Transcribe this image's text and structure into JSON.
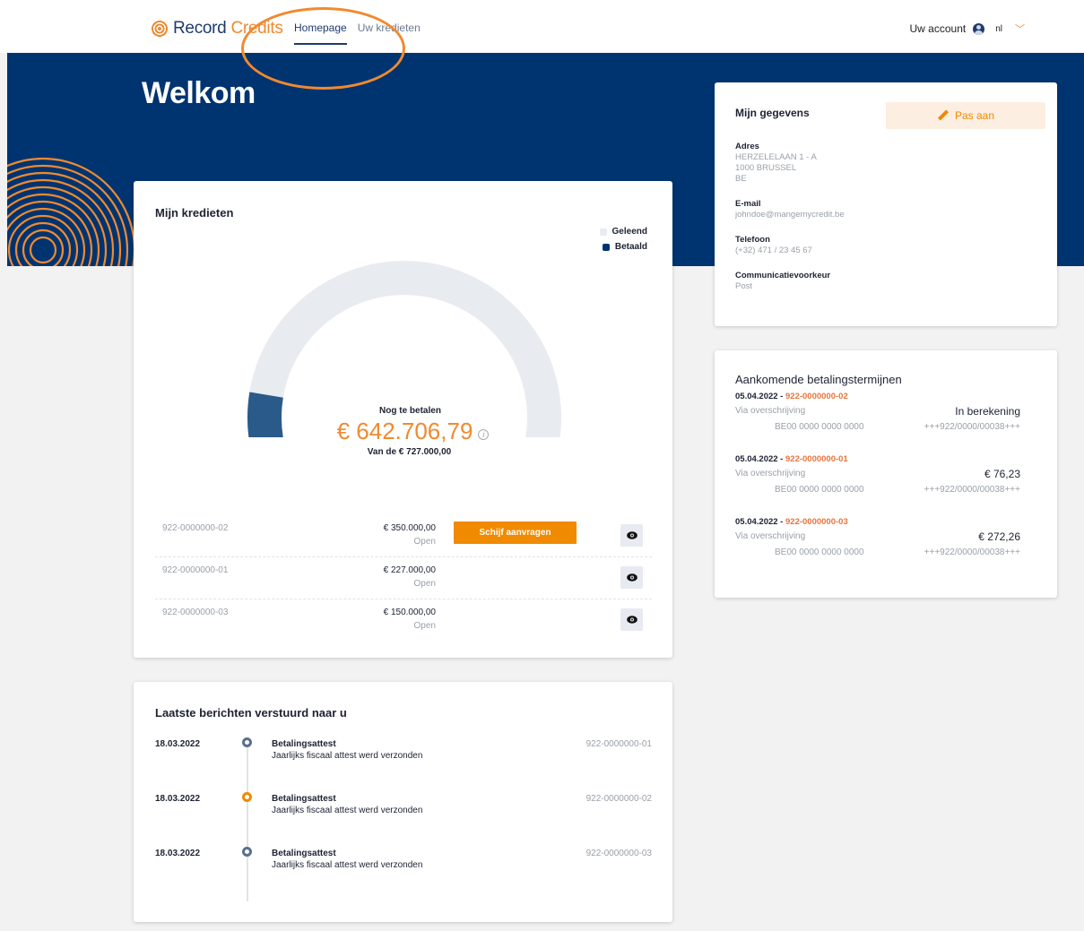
{
  "header": {
    "brand_main": "Record ",
    "brand_accent": "Credits",
    "nav": [
      {
        "label": "Homepage"
      },
      {
        "label": "Uw kredieten"
      }
    ],
    "account_label": "Uw account",
    "language": "nl"
  },
  "hero": {
    "title": "Welkom"
  },
  "credits": {
    "title": "Mijn kredieten",
    "legend": [
      {
        "label": "Geleend",
        "color": "#e8ebf0"
      },
      {
        "label": "Betaald",
        "color": "#003470"
      }
    ],
    "gauge": {
      "label": "Nog te betalen",
      "amount": "€ 642.706,79",
      "subtitle": "Van de € 727.000,00",
      "paid_fraction": 0.116,
      "track_color": "#e8ebf0",
      "paid_color": "#2a5a8a"
    },
    "loans": [
      {
        "id": "922-0000000-02",
        "amount": "€ 350.000,00",
        "status": "Open",
        "action": "Schijf aanvragen"
      },
      {
        "id": "922-0000000-01",
        "amount": "€ 227.000,00",
        "status": "Open"
      },
      {
        "id": "922-0000000-03",
        "amount": "€ 150.000,00",
        "status": "Open"
      }
    ]
  },
  "messages": {
    "title": "Laatste berichten verstuurd naar u",
    "items": [
      {
        "date": "18.03.2022",
        "title": "Betalingsattest",
        "text": "Jaarlijks fiscaal attest werd verzonden",
        "ref": "922-0000000-01"
      },
      {
        "date": "18.03.2022",
        "title": "Betalingsattest",
        "text": "Jaarlijks fiscaal attest werd verzonden",
        "ref": "922-0000000-02"
      },
      {
        "date": "18.03.2022",
        "title": "Betalingsattest",
        "text": "Jaarlijks fiscaal attest werd verzonden",
        "ref": "922-0000000-03"
      }
    ]
  },
  "details": {
    "title": "Mijn gegevens",
    "edit_label": "Pas aan",
    "address_label": "Adres",
    "address_line1": "HERZELELAAN 1 - A",
    "address_line2": "1000 BRUSSEL",
    "address_line3": "BE",
    "email_label": "E-mail",
    "email": "johndoe@mangemycredit.be",
    "phone_label": "Telefoon",
    "phone": "(+32) 471 / 23 45 67",
    "comm_label": "Communicatievoorkeur",
    "comm": "Post"
  },
  "upcoming": {
    "title": "Aankomende betalingstermijnen",
    "items": [
      {
        "date": "05.04.2022",
        "ref": "922-0000000-02",
        "method": "Via overschrijving",
        "amount": "In berekening",
        "iban": "BE00 0000 0000 0000",
        "structured": "+++922/0000/00038+++"
      },
      {
        "date": "05.04.2022",
        "ref": "922-0000000-01",
        "method": "Via overschrijving",
        "amount": "€ 76,23",
        "iban": "BE00 0000 0000 0000",
        "structured": "+++922/0000/00038+++"
      },
      {
        "date": "05.04.2022",
        "ref": "922-0000000-03",
        "method": "Via overschrijving",
        "amount": "€ 272,26",
        "iban": "BE00 0000 0000 0000",
        "structured": "+++922/0000/00038+++"
      }
    ]
  },
  "icons": {
    "logo": "record-credits-logo-icon",
    "user": "user-avatar-icon",
    "chevron": "chevron-down-icon",
    "info": "info-icon",
    "eye": "eye-icon",
    "pencil": "pencil-icon"
  },
  "colors": {
    "brand_navy": "#003470",
    "brand_orange": "#f08a00"
  }
}
